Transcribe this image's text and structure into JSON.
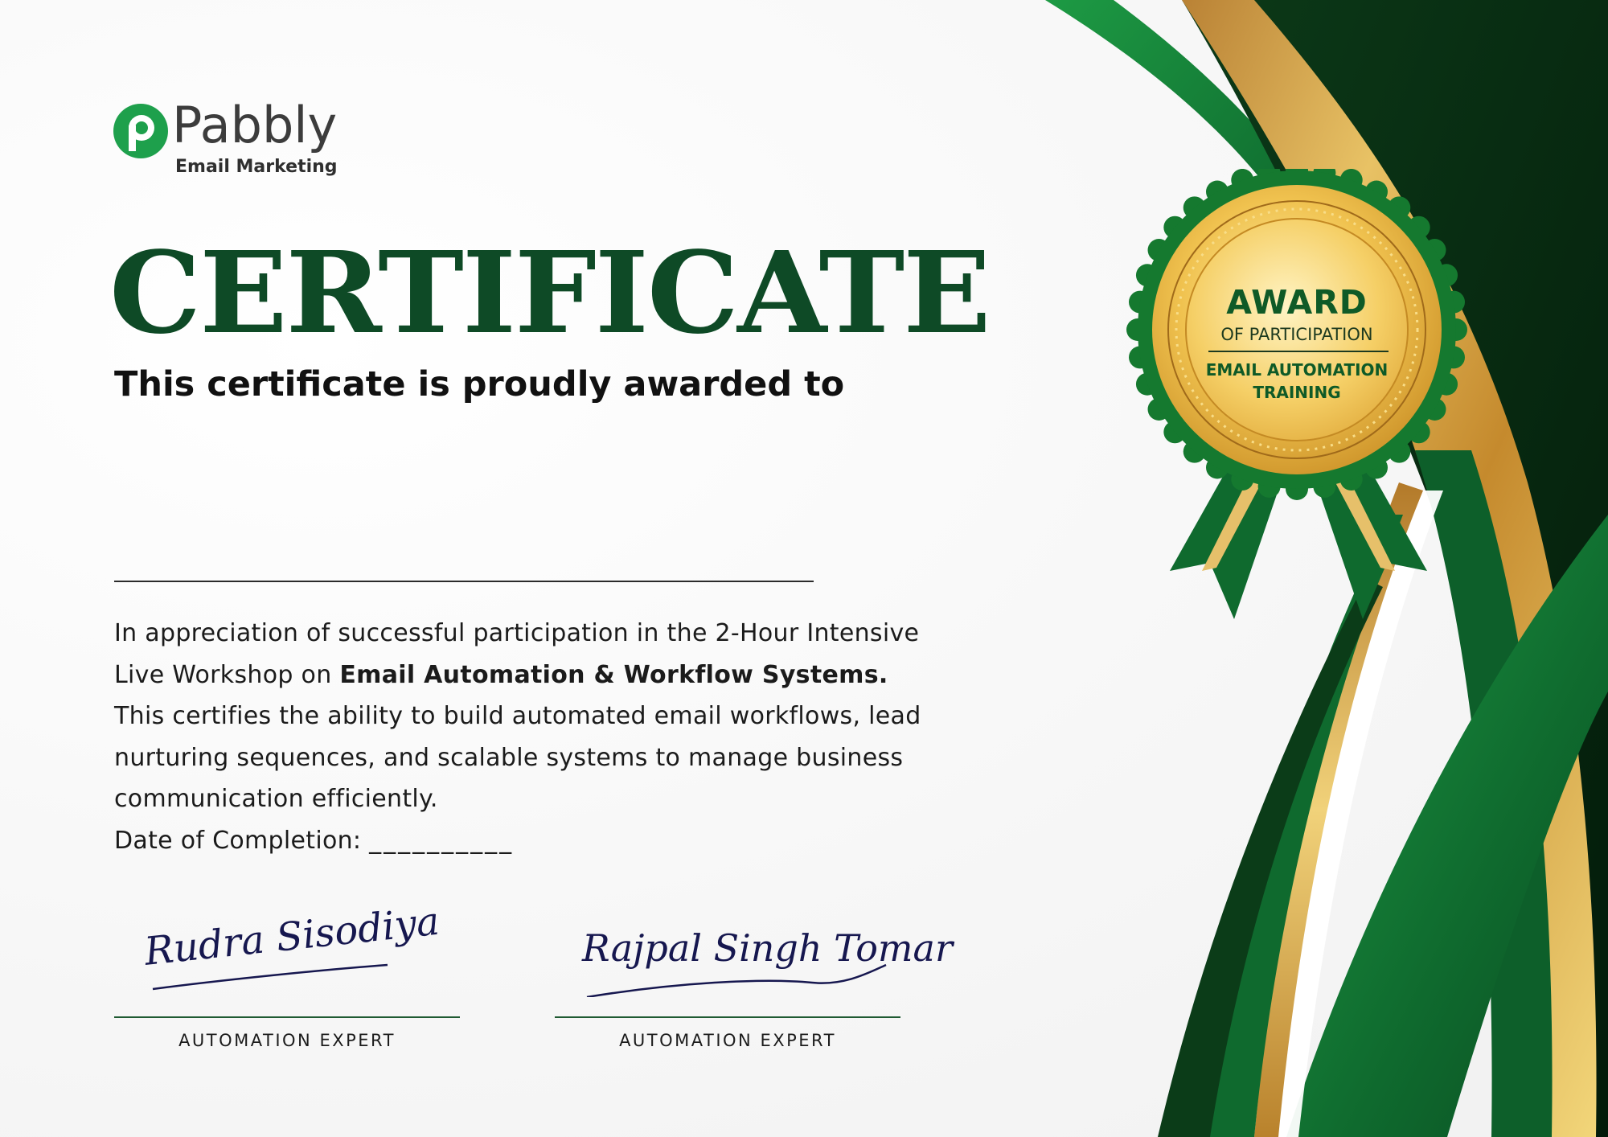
{
  "logo": {
    "brand": "Pabbly",
    "product": "Email Marketing"
  },
  "certificate": {
    "title": "CERTIFICATE",
    "awarded_to": "This certificate is proudly awarded to",
    "body": {
      "line1": "In appreciation of successful participation in the 2-Hour Intensive",
      "line2_prefix": "Live Workshop on ",
      "line2_bold": "Email Automation & Workflow Systems.",
      "line3": "This certifies the ability to build automated email workflows, lead",
      "line4": "nurturing sequences, and scalable systems to manage business",
      "line5": "communication efficiently.",
      "date_label": "Date of Completion:",
      "date_blank": "__________"
    }
  },
  "signatures": [
    {
      "name": "Rudra Sisodiya",
      "role": "AUTOMATION EXPERT"
    },
    {
      "name": "Rajpal Singh Tomar",
      "role": "AUTOMATION EXPERT"
    }
  ],
  "seal": {
    "award": "AWARD",
    "of_participation": "OF PARTICIPATION",
    "training_line1": "EMAIL AUTOMATION",
    "training_line2": "TRAINING"
  },
  "colors": {
    "dark_green": "#0e4a26",
    "green": "#1a8a3a",
    "gold": "#c8902e",
    "navy_ink": "#16174f"
  }
}
